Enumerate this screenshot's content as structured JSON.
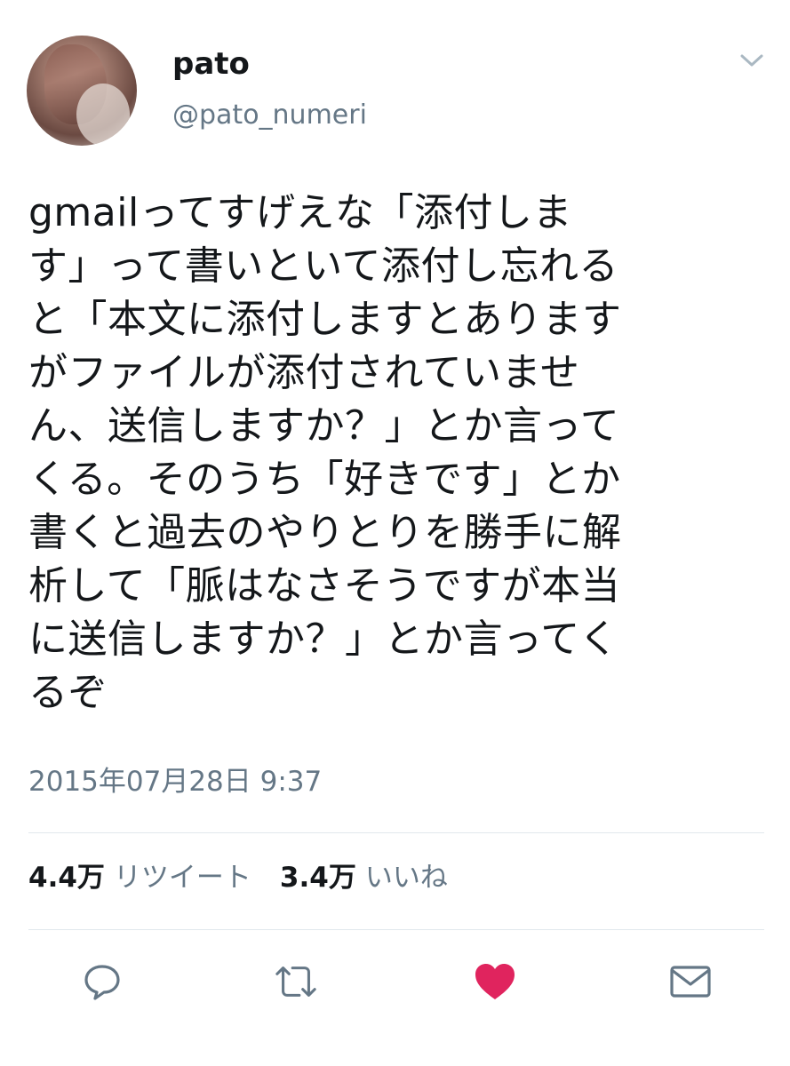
{
  "tweet": {
    "author": {
      "display_name": "pato",
      "handle": "@pato_numeri"
    },
    "text": "gmailってすげえな「添付しま\nす」って書いといて添付し忘れる\nと「本文に添付しますとあります\nがファイルが添付されていませ\nん、送信しますか？」とか言って\nくる。そのうち「好きです」とか\n書くと過去のやりとりを勝手に解\n析して「脈はなさそうですが本当\nに送信しますか？」とか言ってく\nるぞ",
    "timestamp": "2015年07月28日 9:37",
    "stats": {
      "retweets_count": "4.4万",
      "retweets_label": "リツイート",
      "likes_count": "3.4万",
      "likes_label": "いいね"
    }
  },
  "actions": {
    "reply_icon": "reply-icon",
    "retweet_icon": "retweet-icon",
    "like_icon": "heart-icon",
    "dm_icon": "envelope-icon"
  },
  "colors": {
    "text": "#14171a",
    "secondary": "#657786",
    "like_active": "#e0245e",
    "divider": "#e1e8ed"
  }
}
